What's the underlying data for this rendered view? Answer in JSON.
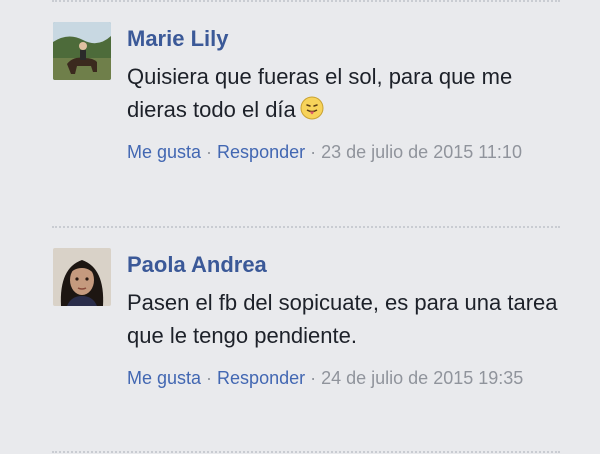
{
  "comments": [
    {
      "author": "Marie Lily",
      "text": "Quisiera que fueras el sol, para que me dieras todo el día",
      "emoji": "tongue-out-emoji-icon",
      "like_label": "Me gusta",
      "reply_label": "Responder",
      "separator": " · ",
      "timestamp": "23 de julio de 2015 11:10"
    },
    {
      "author": "Paola Andrea",
      "text": "Pasen el fb del sopicuate, es para una tarea que le tengo pendiente.",
      "like_label": "Me gusta",
      "reply_label": "Responder",
      "separator": " · ",
      "timestamp": "24 de julio de 2015 19:35"
    }
  ],
  "colors": {
    "background": "#e9eaed",
    "author_link": "#3b5998",
    "action_link": "#4267b2",
    "meta_text": "#90949c",
    "body_text": "#1d2129"
  }
}
